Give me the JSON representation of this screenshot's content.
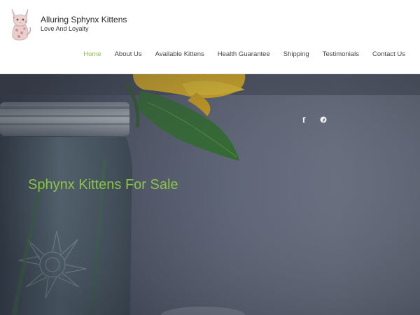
{
  "site": {
    "title": "Alluring Sphynx Kittens",
    "tagline": "Love And Loyalty"
  },
  "nav": {
    "items": [
      {
        "label": "Home",
        "active": true
      },
      {
        "label": "About Us",
        "active": false
      },
      {
        "label": "Available Kittens",
        "active": false
      },
      {
        "label": "Health Guarantee",
        "active": false
      },
      {
        "label": "Shipping",
        "active": false
      },
      {
        "label": "Testimonials",
        "active": false
      },
      {
        "label": "Contact Us",
        "active": false
      }
    ]
  },
  "hero": {
    "title": "Sphynx Kittens For Sale",
    "social": [
      {
        "icon": "facebook-icon",
        "glyph": "f"
      },
      {
        "icon": "pinterest-icon"
      }
    ]
  },
  "colors": {
    "accent": "#8bc34a",
    "nav_text": "#444444",
    "hero_overlay": "#4e5566"
  }
}
